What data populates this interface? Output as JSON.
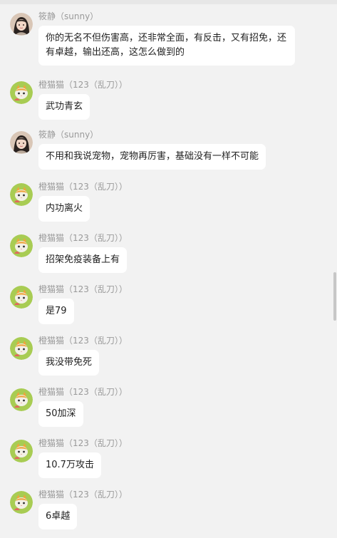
{
  "users": {
    "sunny": {
      "name": "筱静（sunny）",
      "avatar_icon": "girl-avatar-icon"
    },
    "cat": {
      "name": "橙猫猫（123（乱刀））",
      "avatar_icon": "cat-avatar-icon"
    }
  },
  "messages": [
    {
      "sender": "筱静（sunny）",
      "text": "你的无名不但伤害高，还非常全面，有反击，又有招免，还有卓越，输出还高，这怎么做到的"
    },
    {
      "sender": "橙猫猫（123（乱刀））",
      "text": "武功青玄"
    },
    {
      "sender": "筱静（sunny）",
      "text": "不用和我说宠物，宠物再厉害，基础没有一样不可能"
    },
    {
      "sender": "橙猫猫（123（乱刀））",
      "text": "内功离火"
    },
    {
      "sender": "橙猫猫（123（乱刀））",
      "text": "招架免疫装备上有"
    },
    {
      "sender": "橙猫猫（123（乱刀））",
      "text": "是79"
    },
    {
      "sender": "橙猫猫（123（乱刀））",
      "text": "我没带免死"
    },
    {
      "sender": "橙猫猫（123（乱刀））",
      "text": "50加深"
    },
    {
      "sender": "橙猫猫（123（乱刀））",
      "text": "10.7万攻击"
    },
    {
      "sender": "橙猫猫（123（乱刀））",
      "text": "6卓越"
    }
  ]
}
